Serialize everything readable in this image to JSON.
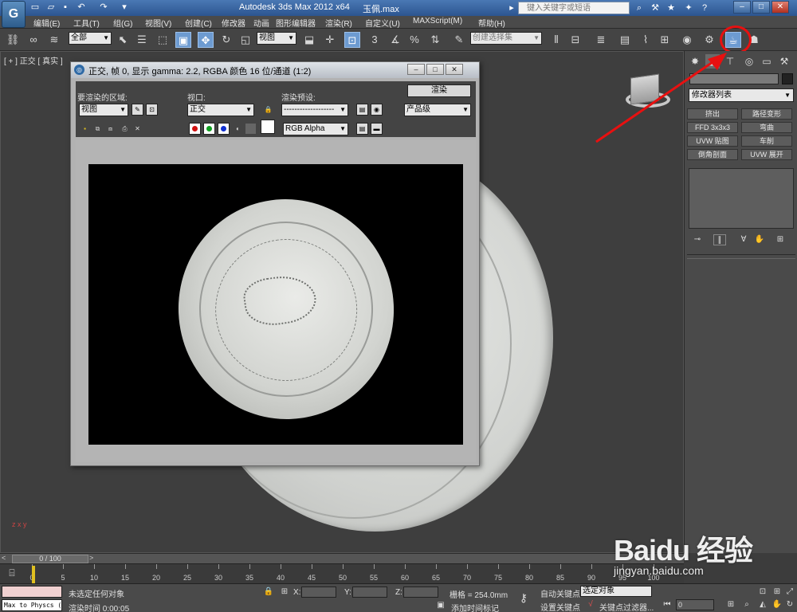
{
  "titlebar": {
    "app_logo": "G",
    "title": "Autodesk 3ds Max  2012 x64",
    "file": "玉佩.max",
    "search_placeholder": "键入关键字或短语",
    "help_icon": "?"
  },
  "menubar": {
    "items": [
      "编辑(E)",
      "工具(T)",
      "组(G)",
      "视图(V)",
      "创建(C)",
      "修改器",
      "动画",
      "图形编辑器",
      "渲染(R)",
      "自定义(U)",
      "MAXScript(M)",
      "帮助(H)"
    ]
  },
  "toolbar": {
    "selection_filter": "全部",
    "reference_coord": "视图",
    "named_selection": "创建选择集"
  },
  "viewport": {
    "label": "[ + ] 正交 [ 真实 ]",
    "axis_label": "z x y"
  },
  "render_window": {
    "title": "正交, 帧 0, 显示 gamma: 2.2, RGBA 颜色 16 位/通道 (1:2)",
    "area_label": "要渲染的区域:",
    "area_value": "视图",
    "viewport_label": "视口:",
    "viewport_value": "正交",
    "preset_label": "渲染预设:",
    "preset_value": "-------------------",
    "render_button": "渲染",
    "quality_value": "产品级",
    "channel_value": "RGB Alpha"
  },
  "command_panel": {
    "modifier_list": "修改器列表",
    "modifiers": [
      "挤出",
      "路径变形",
      "FFD 3x3x3",
      "弯曲",
      "UVW 贴图",
      "车削",
      "倒角剖面",
      "UVW 展开"
    ]
  },
  "time_slider": {
    "frame": "0 / 100",
    "left_arrow": "<",
    "right_arrow": ">"
  },
  "trackbar": {
    "ticks": [
      "0",
      "5",
      "10",
      "15",
      "20",
      "25",
      "30",
      "35",
      "40",
      "45",
      "50",
      "55",
      "60",
      "65",
      "70",
      "75",
      "80",
      "85",
      "90",
      "95",
      "100"
    ]
  },
  "statusbar": {
    "maxscript": "Max to Physcs (",
    "selection_status": "未选定任何对象",
    "render_time": "渲染时间  0:00:05",
    "x_label": "X:",
    "y_label": "Y:",
    "z_label": "Z:",
    "grid": "栅格 = 254.0mm",
    "auto_key": "自动关键点",
    "selected_object": "选定对象",
    "set_key": "设置关键点",
    "key_filters": "关键点过滤器...",
    "add_time_tag": "添加时间标记",
    "frame_field": "0"
  },
  "watermark": {
    "main": "Baidu 经验",
    "sub": "jingyan.baidu.com"
  },
  "colors": {
    "accent": "#6d9bd1",
    "annotation": "#e81010"
  }
}
